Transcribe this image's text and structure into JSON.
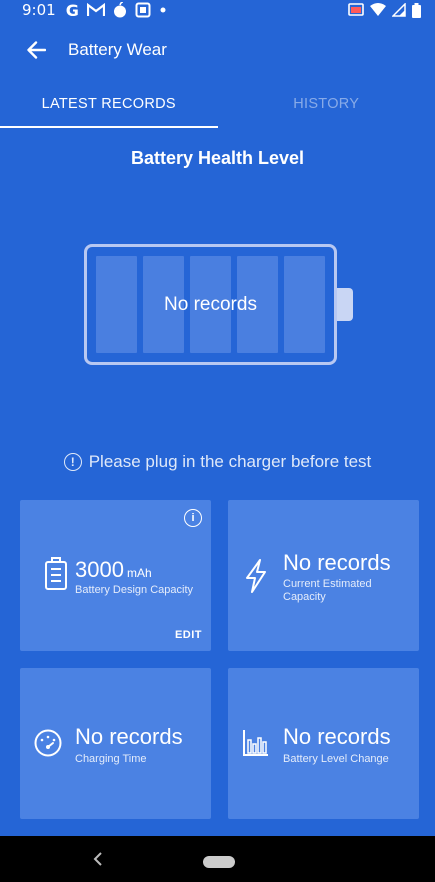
{
  "status_bar": {
    "time": "9:01",
    "left_icons": [
      "google-icon",
      "gmail-icon",
      "apple-icon",
      "news-icon",
      "dot-icon"
    ],
    "right_icons": [
      "cast-icon",
      "wifi-icon",
      "signal-icon",
      "battery-icon"
    ]
  },
  "app_bar": {
    "title": "Battery Wear",
    "back_icon": "arrow-back-icon"
  },
  "tabs": [
    {
      "label": "LATEST RECORDS",
      "active": true
    },
    {
      "label": "HISTORY",
      "active": false
    }
  ],
  "section_title": "Battery Health Level",
  "battery": {
    "status_text": "No records",
    "cells": 5
  },
  "notice": {
    "icon": "exclamation-circle-icon",
    "text": "Please plug in the charger before test"
  },
  "cards": {
    "design_capacity": {
      "value": "3000",
      "unit": "mAh",
      "label": "Battery Design Capacity",
      "action": "EDIT",
      "info_icon": "info-icon",
      "icon": "battery-list-icon"
    },
    "estimated_capacity": {
      "value": "No records",
      "label_line1": "Current Estimated",
      "label_line2": "Capacity",
      "icon": "lightning-icon"
    },
    "charging_time": {
      "value": "No records",
      "label": "Charging Time",
      "icon": "speedometer-icon"
    },
    "level_change": {
      "value": "No records",
      "label": "Battery Level Change",
      "icon": "bar-chart-icon"
    }
  },
  "colors": {
    "background": "#2565d6",
    "card": "#4b82e3",
    "battery_cell": "#4a7fe0",
    "battery_outline": "#b8c8f2"
  }
}
